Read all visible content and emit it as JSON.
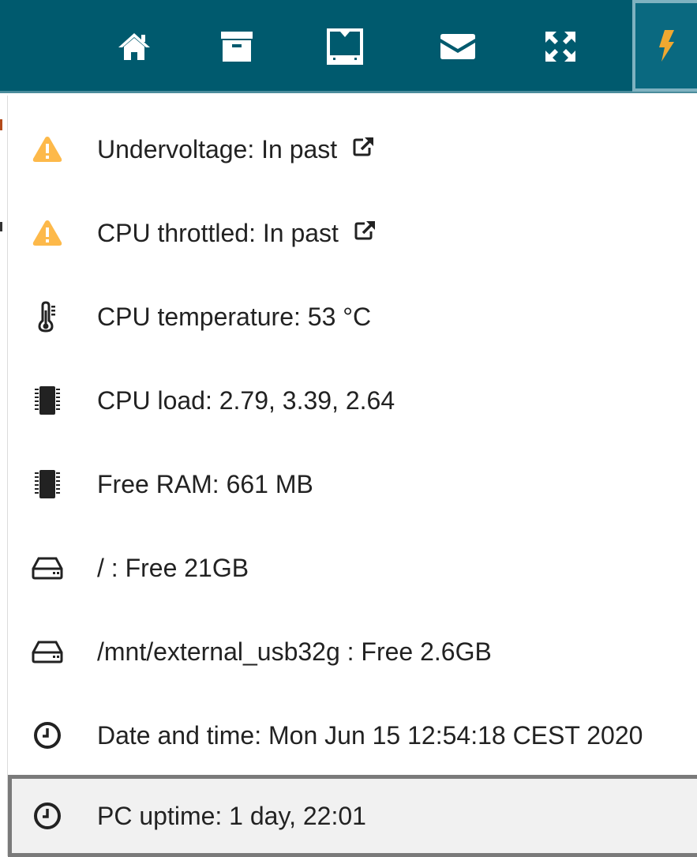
{
  "navbar": {
    "buttons": [
      {
        "name": "home",
        "icon": "home-icon"
      },
      {
        "name": "archive",
        "icon": "archive-icon"
      },
      {
        "name": "tray",
        "icon": "inbox-tray-icon"
      },
      {
        "name": "mail",
        "icon": "envelope-icon"
      },
      {
        "name": "fullscreen",
        "icon": "expand-icon"
      },
      {
        "name": "power",
        "icon": "lightning-bolt-icon",
        "active": true
      }
    ],
    "colors": {
      "background": "#005a6e",
      "active_bolt": "#f0a830"
    }
  },
  "status_menu": {
    "items": [
      {
        "icon": "warning-icon",
        "label": "Undervoltage: In past",
        "external_link_icon": "external-link-icon"
      },
      {
        "icon": "warning-icon",
        "label": "CPU throttled: In past",
        "external_link_icon": "external-link-icon"
      },
      {
        "icon": "thermometer-icon",
        "label": "CPU temperature: 53 °C"
      },
      {
        "icon": "microchip-icon",
        "label": "CPU load: 2.79, 3.39, 2.64"
      },
      {
        "icon": "microchip-icon",
        "label": "Free RAM: 661 MB"
      },
      {
        "icon": "hard-drive-icon",
        "label": "/ : Free 21GB"
      },
      {
        "icon": "hard-drive-icon",
        "label": "/mnt/external_usb32g : Free 2.6GB"
      },
      {
        "icon": "clock-icon",
        "label": "Date and time: Mon Jun 15 12:54:18 CEST 2020"
      },
      {
        "icon": "clock-icon",
        "label": "PC uptime: 1 day, 22:01",
        "selected": true
      }
    ],
    "colors": {
      "warning": "#fdb94a",
      "text": "#222222"
    }
  }
}
